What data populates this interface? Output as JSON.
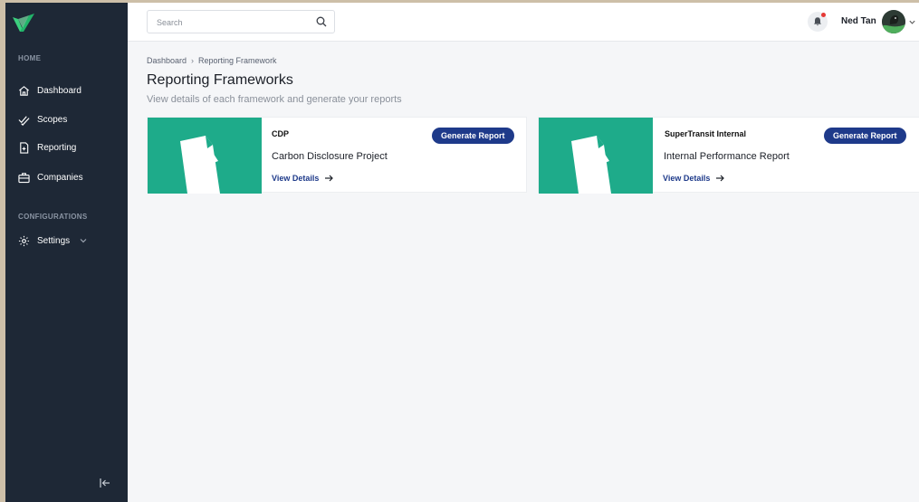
{
  "sidebar": {
    "sections": [
      {
        "label": "HOME"
      },
      {
        "label": "CONFIGURATIONS"
      }
    ],
    "items": [
      {
        "label": "Dashboard",
        "icon": "home-icon"
      },
      {
        "label": "Scopes",
        "icon": "double-check-icon"
      },
      {
        "label": "Reporting",
        "icon": "document-icon"
      },
      {
        "label": "Companies",
        "icon": "briefcase-icon"
      },
      {
        "label": "Settings",
        "icon": "gear-icon"
      }
    ]
  },
  "header": {
    "search_placeholder": "Search",
    "user_name": "Ned Tan"
  },
  "breadcrumb": {
    "items": [
      "Dashboard",
      "Reporting Framework"
    ]
  },
  "page": {
    "title": "Reporting Frameworks",
    "subtitle": "View details of each framework and generate your reports"
  },
  "frameworks": [
    {
      "short_name": "CDP",
      "full_name": "Carbon Disclosure Project",
      "details_label": "View Details",
      "button_label": "Generate Report"
    },
    {
      "short_name": "SuperTransit Internal",
      "full_name": "Internal Performance Report",
      "details_label": "View Details",
      "button_label": "Generate Report"
    }
  ],
  "colors": {
    "sidebar_bg": "#1e2836",
    "accent": "#1e3a8a",
    "thumb_green": "#1eab8a",
    "notification_dot": "#e53935"
  }
}
